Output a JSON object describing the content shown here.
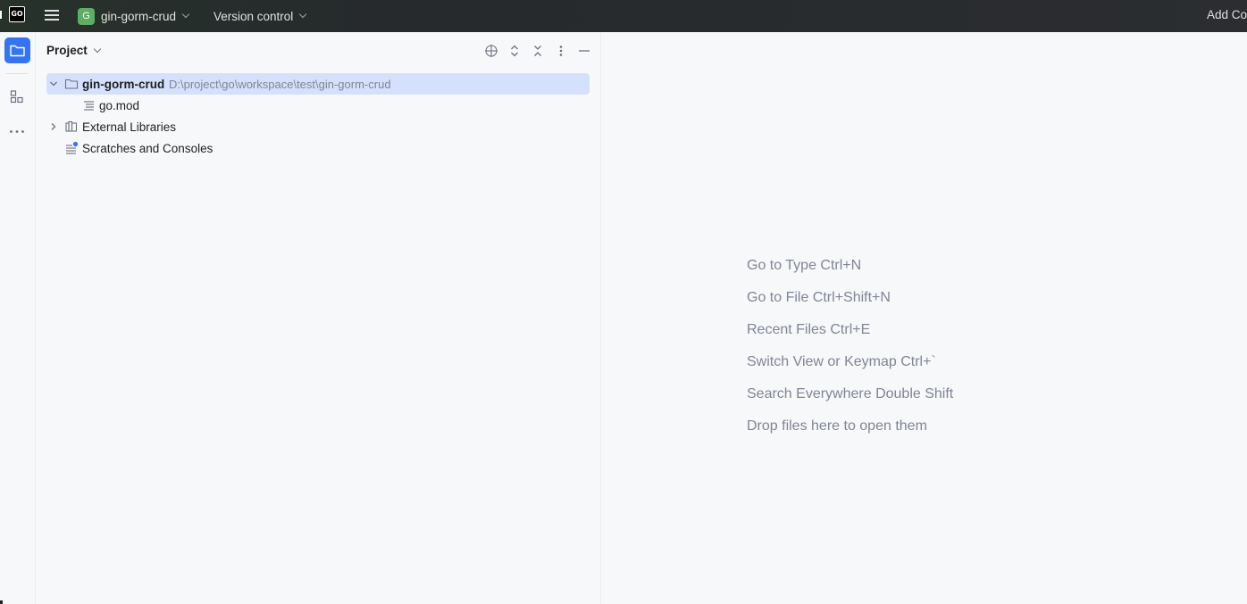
{
  "titlebar": {
    "logo_text": "GO",
    "project_badge": "G",
    "project_name": "gin-gorm-crud",
    "vcs_label": "Version control",
    "add_config_label": "Add Co"
  },
  "toolstrip": {
    "items": [
      {
        "icon": "folder-icon",
        "active": true
      },
      {
        "icon": "structure-icon",
        "active": false
      },
      {
        "icon": "more-icon",
        "active": false
      }
    ]
  },
  "panel": {
    "title": "Project",
    "actions": [
      "locate-icon",
      "expand-all-icon",
      "collapse-all-icon",
      "options-icon",
      "hide-icon"
    ],
    "tree": [
      {
        "label": "gin-gorm-crud",
        "path": "D:\\project\\go\\workspace\\test\\gin-gorm-crud",
        "icon": "folder-icon",
        "expanded": true,
        "selected": true
      },
      {
        "label": "go.mod",
        "icon": "text-file-icon"
      },
      {
        "label": "External Libraries",
        "icon": "library-icon",
        "expanded": false
      },
      {
        "label": "Scratches and Consoles",
        "icon": "scratches-icon"
      }
    ]
  },
  "editor": {
    "hints": [
      "Go to Type Ctrl+N",
      "Go to File Ctrl+Shift+N",
      "Recent Files Ctrl+E",
      "Switch View or Keymap Ctrl+`",
      "Search Everywhere Double Shift",
      "Drop files here to open them"
    ]
  },
  "colors": {
    "accent": "#3574f0",
    "selection": "#d5e1fc",
    "titlebar": "#2b2d30",
    "hint_text": "#818594"
  }
}
